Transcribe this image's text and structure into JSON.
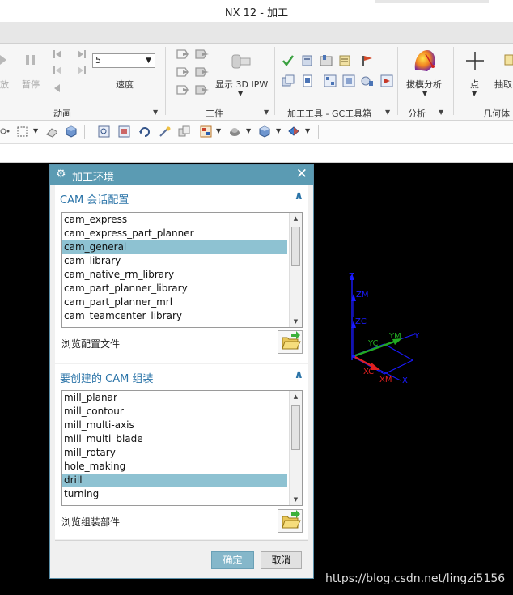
{
  "window": {
    "title": "NX 12 - 加工"
  },
  "ribbon": {
    "animation": {
      "play_label": "放",
      "pause_label": "暂停",
      "speed_value": "5",
      "speed_label": "速度",
      "group_label": "动画"
    },
    "workpiece": {
      "display_3d_ipw_label": "显示 3D IPW",
      "group_label": "工件"
    },
    "machining_tools": {
      "group_label": "加工工具 - GC工具箱"
    },
    "analysis": {
      "draft_analysis_label": "拔模分析",
      "group_label": "分析"
    },
    "geometry": {
      "point_label": "点",
      "extract_label": "抽取",
      "group_label": "几何体"
    }
  },
  "dialog": {
    "title": "加工环境",
    "session_section": {
      "header": "CAM 会话配置",
      "items": [
        "cam_express",
        "cam_express_part_planner",
        "cam_general",
        "cam_library",
        "cam_native_rm_library",
        "cam_part_planner_library",
        "cam_part_planner_mrl",
        "cam_teamcenter_library"
      ],
      "selected": "cam_general",
      "browse_label": "浏览配置文件"
    },
    "setup_section": {
      "header": "要创建的 CAM 组装",
      "items": [
        "mill_planar",
        "mill_contour",
        "mill_multi-axis",
        "mill_multi_blade",
        "mill_rotary",
        "hole_making",
        "drill",
        "turning"
      ],
      "selected": "drill",
      "browse_label": "浏览组装部件"
    },
    "ok_label": "确定",
    "cancel_label": "取消"
  },
  "viewport": {
    "axes_labels": {
      "z": "Z",
      "zm": "ZM",
      "zc": "ZC",
      "yc": "YC",
      "ym": "YM",
      "y": "Y",
      "xc": "XC",
      "xm": "XM",
      "x": "X"
    },
    "watermark": "https://blog.csdn.net/lingzi5156"
  },
  "colors": {
    "dialog_title_bg": "#5b9bb3",
    "section_header_text": "#2b74a8",
    "selected_row": "#8ec2d2",
    "ok_button": "#85b7ca",
    "axis_blue": "#1a1aff",
    "axis_green": "#22aa22",
    "axis_red": "#e02020"
  }
}
